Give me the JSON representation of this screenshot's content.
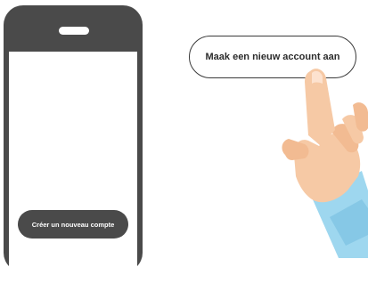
{
  "phone": {
    "button_label": "Créer un nouveau compte"
  },
  "callout": {
    "label": "Maak een nieuw account aan"
  },
  "colors": {
    "phone_body": "#4a4a4a",
    "skin": "#f6c9a5",
    "sleeve": "#9ed7ef"
  }
}
